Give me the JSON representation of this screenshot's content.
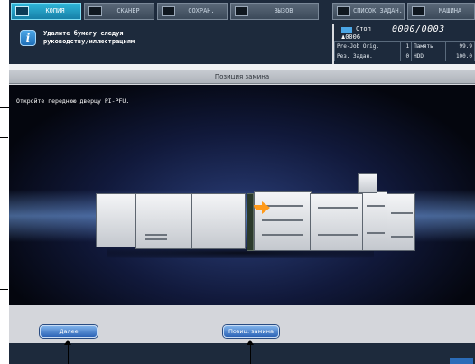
{
  "tabs": [
    {
      "label": "КОПИЯ",
      "active": true
    },
    {
      "label": "СКАНЕР",
      "active": false
    },
    {
      "label": "СОХРАН.",
      "active": false
    },
    {
      "label": "ВЫЗОВ",
      "active": false
    },
    {
      "label": "СПИСОК ЗАДАН.",
      "active": false
    },
    {
      "label": "МАШИНА",
      "active": false
    }
  ],
  "message": {
    "line1": "Удалите бумагу следуя",
    "line2": "руководству/иллюстрациям"
  },
  "status": {
    "state": "Стоп",
    "user_code": "0006",
    "counter": "0000/0003",
    "rows": [
      {
        "label": "Pre-Job Orig.",
        "value": "1",
        "label2": "Память",
        "value2": "99.9"
      },
      {
        "label": "Рез. Задан.",
        "value": "0",
        "label2": "HDD",
        "value2": "100.0"
      }
    ]
  },
  "title": "Позиция замина",
  "instruction": "Откройте переднюю дверцу PI-PFU.",
  "buttons": {
    "next": "Далее",
    "jam_position": "Позиц. замина"
  },
  "colors": {
    "accent": "#1f7fb0",
    "button": "#3a74c6",
    "arrow": "#ff9a1a"
  }
}
